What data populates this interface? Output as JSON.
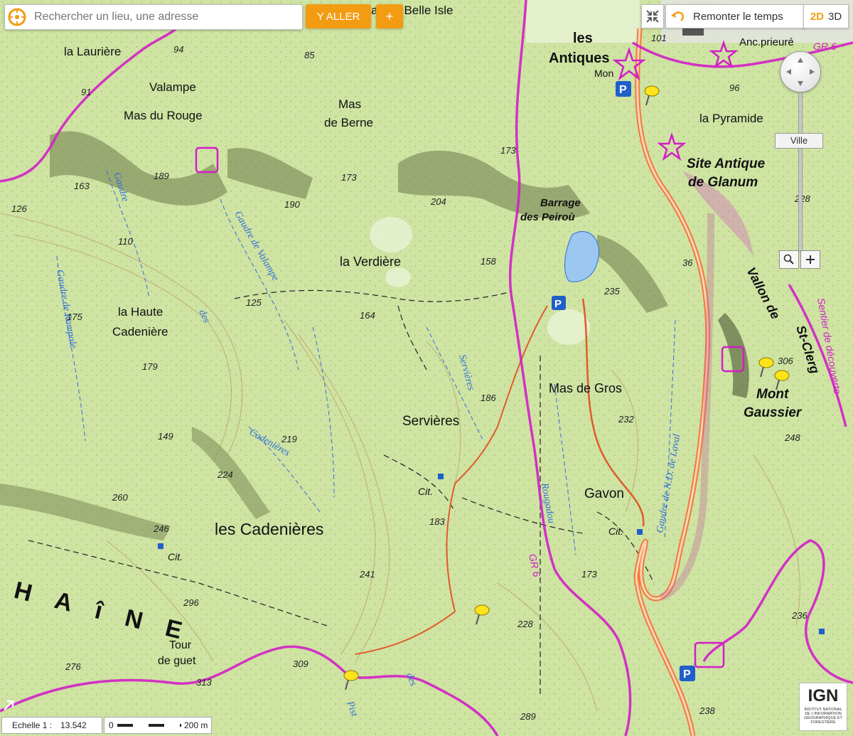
{
  "search": {
    "placeholder": "Rechercher un lieu, une adresse",
    "go_label": "Y ALLER",
    "plus_label": "+"
  },
  "toolbar": {
    "history_label": "Remonter le temps",
    "mode_2d": "2D",
    "mode_3d": "3D"
  },
  "nav": {
    "ville_label": "Ville"
  },
  "scale": {
    "label": "Echelle 1 :",
    "value": "13.542",
    "bar_start": "0",
    "bar_end": "200 m"
  },
  "brand": {
    "logo_text": "IGN",
    "logo_subtext": "INSTITUT NATIONAL DE L'INFORMATION GÉOGRAPHIQUE ET FORESTIÈRE"
  },
  "colors": {
    "terrain": "#cfe3a3",
    "contour": "#b88452",
    "river": "#2f6fd6",
    "trail": "#d21ec8",
    "road": "#f07a3a",
    "accent": "#f39c12"
  },
  "places": {
    "mas_belle_isle": "Mas de Belle Isle",
    "la_lauriere": "la Laurière",
    "valampe": "Valampe",
    "mas_du_rouge": "Mas du Rouge",
    "mas_de_berne_1": "Mas",
    "mas_de_berne_2": "de Berne",
    "les_antiques_1": "les",
    "les_antiques_2": "Antiques",
    "mon": "Mon",
    "anc_prieure": "Anc.prieuré",
    "la_pyramide": "la Pyramide",
    "site_antique_1": "Site Antique",
    "site_antique_2": "de Glanum",
    "barrage_1": "Barrage",
    "barrage_2": "des Peiroù",
    "la_verdiere": "la Verdière",
    "la_haute_1": "la Haute",
    "la_haute_2": "Cadenière",
    "vallon_1": "Vallon de",
    "vallon_2": "St-Clerg",
    "mas_de_gros": "Mas de Gros",
    "mont_gaussier_1": "Mont",
    "mont_gaussier_2": "Gaussier",
    "servieres": "Servières",
    "gavon": "Gavon",
    "les_cadenieres": "les Cadenières",
    "chaine": "HAîNE",
    "tour_1": "Tour",
    "tour_2": "de guet",
    "cit_1": "Cit.",
    "cit_2": "Cit.",
    "cit_3": "Cit."
  },
  "waterways": {
    "gaudre_110": "Gaudre",
    "gaudre_des": "des",
    "gaudre_valampe": "Gaudre de Valampe",
    "gaudre_rampale": "Gaudre de Rampale",
    "cadenieres": "Cadenières",
    "servieres_w": "Servières",
    "rougadou": "Rougadou",
    "gaudre_laval": "Gaudre de N.D. de Laval",
    "des_pist": "des",
    "pist": "Pist"
  },
  "trails": {
    "gr6": "GR 6",
    "gr65": "GR 6",
    "sentier": "Sentier de découverte"
  },
  "elevations": [
    "94",
    "85",
    "91",
    "101",
    "96",
    "189",
    "163",
    "190",
    "173",
    "204",
    "173",
    "126",
    "110",
    "158",
    "228",
    "235",
    "36",
    "175",
    "125",
    "164",
    "179",
    "186",
    "232",
    "306",
    "248",
    "149",
    "219",
    "224",
    "260",
    "246",
    "183",
    "241",
    "173",
    "236",
    "228",
    "296",
    "309",
    "313",
    "276",
    "289",
    "238"
  ]
}
